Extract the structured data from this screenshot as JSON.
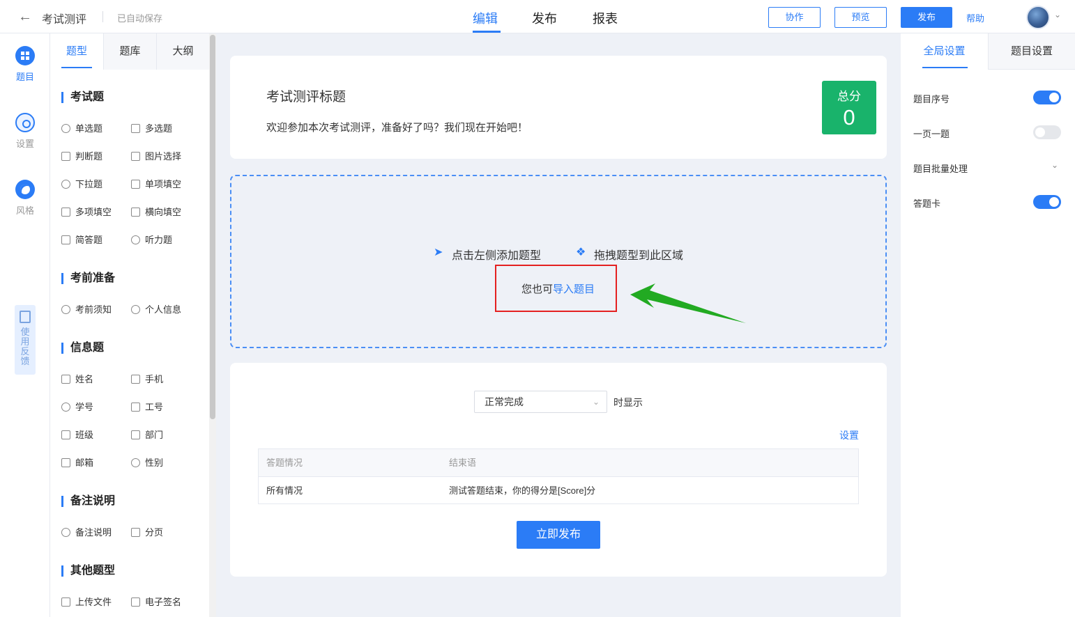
{
  "header": {
    "back_icon": "arrow-left-icon",
    "title": "考试测评",
    "autosave": "已自动保存",
    "tabs": [
      "编辑",
      "发布",
      "报表"
    ],
    "active_tab": "编辑",
    "collaborate": "协作",
    "preview": "预览",
    "publish": "发布",
    "help": "帮助"
  },
  "rail": {
    "items": [
      {
        "label": "题目",
        "icon": "grid-icon",
        "active": true
      },
      {
        "label": "设置",
        "icon": "gear-icon"
      },
      {
        "label": "风格",
        "icon": "palette-icon"
      }
    ],
    "feedback": "使用反馈"
  },
  "qpanel": {
    "tabs": [
      "题型",
      "题库",
      "大纲"
    ],
    "sections": [
      {
        "title": "考试题",
        "items": [
          "单选题",
          "多选题",
          "判断题",
          "图片选择",
          "下拉题",
          "单项填空",
          "多项填空",
          "横向填空",
          "简答题",
          "听力题"
        ]
      },
      {
        "title": "考前准备",
        "items": [
          "考前须知",
          "个人信息"
        ]
      },
      {
        "title": "信息题",
        "items": [
          "姓名",
          "手机",
          "学号",
          "工号",
          "班级",
          "部门",
          "邮箱",
          "性别"
        ]
      },
      {
        "title": "备注说明",
        "items": [
          "备注说明",
          "分页"
        ]
      },
      {
        "title": "其他题型",
        "items": [
          "上传文件",
          "电子签名"
        ]
      }
    ]
  },
  "survey": {
    "title": "考试测评标题",
    "description": "欢迎参加本次考试测评，准备好了吗？我们现在开始吧！",
    "score_label": "总分",
    "score_value": "0"
  },
  "dropzone": {
    "hint_click": "点击左侧添加题型",
    "hint_drag": "拖拽题型到此区域",
    "import_prefix": "您也可",
    "import_link": "导入题目"
  },
  "ending": {
    "select_value": "正常完成",
    "after_select": "时显示",
    "settings_link": "设置",
    "table_headers": [
      "答题情况",
      "结束语"
    ],
    "table_rows": [
      [
        "所有情况",
        "测试答题结束，你的得分是[Score]分"
      ]
    ],
    "publish_now": "立即发布"
  },
  "settings_panel": {
    "tabs": [
      "全局设置",
      "题目设置"
    ],
    "items": [
      {
        "label": "题目序号",
        "toggle": true
      },
      {
        "label": "一页一题",
        "toggle": false
      },
      {
        "label": "题目批量处理",
        "collapsible": true
      },
      {
        "label": "答题卡",
        "toggle": true
      }
    ]
  },
  "colors": {
    "accent": "#2b7cf6",
    "score_bg": "#19b36b",
    "highlight_box": "#e42020",
    "arrow": "#22aa22"
  }
}
